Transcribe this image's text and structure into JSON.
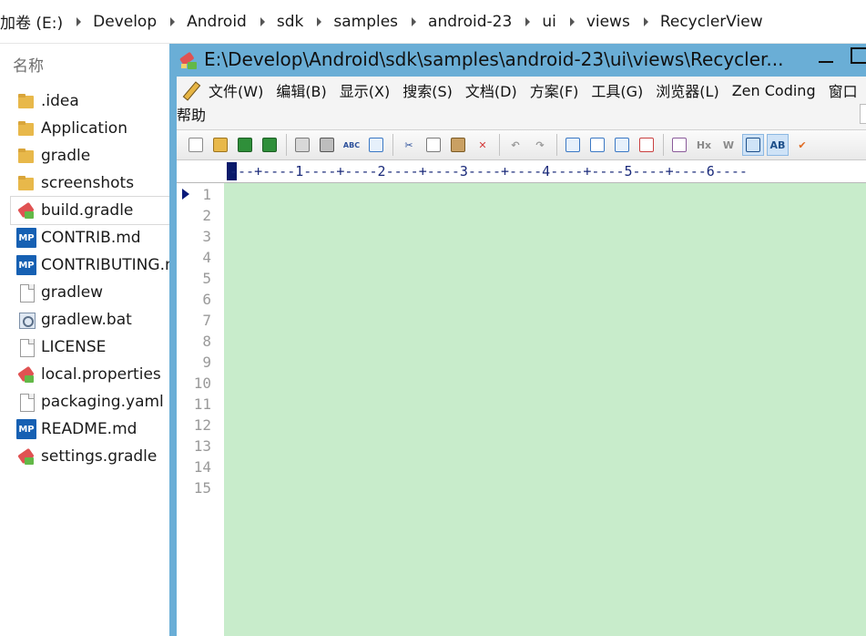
{
  "breadcrumb": [
    "加卷 (E:)",
    "Develop",
    "Android",
    "sdk",
    "samples",
    "android-23",
    "ui",
    "views",
    "RecyclerView"
  ],
  "explorer": {
    "column_header": "名称",
    "files": [
      {
        "name": ".idea",
        "icon": "folder-icon",
        "kind": "folder"
      },
      {
        "name": "Application",
        "icon": "folder-icon",
        "kind": "folder"
      },
      {
        "name": "gradle",
        "icon": "folder-icon",
        "kind": "folder"
      },
      {
        "name": "screenshots",
        "icon": "folder-icon",
        "kind": "folder"
      },
      {
        "name": "build.gradle",
        "icon": "editplus-file-icon",
        "kind": "ep",
        "selected": true
      },
      {
        "name": "CONTRIB.md",
        "icon": "markdown-file-icon",
        "kind": "md",
        "badge": "MP"
      },
      {
        "name": "CONTRIBUTING.md",
        "icon": "markdown-file-icon",
        "kind": "md",
        "badge": "MP"
      },
      {
        "name": "gradlew",
        "icon": "blank-file-icon",
        "kind": "doc"
      },
      {
        "name": "gradlew.bat",
        "icon": "batch-file-icon",
        "kind": "bat"
      },
      {
        "name": "LICENSE",
        "icon": "blank-file-icon",
        "kind": "doc"
      },
      {
        "name": "local.properties",
        "icon": "editplus-file-icon",
        "kind": "ep"
      },
      {
        "name": "packaging.yaml",
        "icon": "blank-file-icon",
        "kind": "doc"
      },
      {
        "name": "README.md",
        "icon": "markdown-file-icon",
        "kind": "md",
        "badge": "MP"
      },
      {
        "name": "settings.gradle",
        "icon": "editplus-file-icon",
        "kind": "ep"
      }
    ]
  },
  "editor": {
    "title": "E:\\Develop\\Android\\sdk\\samples\\android-23\\ui\\views\\Recycler...",
    "menu_row1": [
      "文件(W)",
      "编辑(B)",
      "显示(X)",
      "搜索(S)",
      "文档(D)",
      "方案(F)",
      "工具(G)",
      "浏览器(L)",
      "Zen Coding",
      "窗口"
    ],
    "menu_row2": [
      "帮助"
    ],
    "toolbar": [
      {
        "icon": "new-file-icon"
      },
      {
        "icon": "open-folder-icon"
      },
      {
        "icon": "save-icon"
      },
      {
        "icon": "save-all-icon"
      },
      {
        "sep": true
      },
      {
        "icon": "print-preview-icon"
      },
      {
        "icon": "print-icon"
      },
      {
        "icon": "spell-check-icon",
        "glyph": "ABC"
      },
      {
        "icon": "browser-preview-icon"
      },
      {
        "sep": true
      },
      {
        "icon": "cut-icon",
        "glyph": "✂"
      },
      {
        "icon": "copy-icon"
      },
      {
        "icon": "paste-icon"
      },
      {
        "icon": "delete-icon",
        "glyph": "✕"
      },
      {
        "sep": true
      },
      {
        "icon": "undo-icon",
        "glyph": "↶"
      },
      {
        "icon": "redo-icon",
        "glyph": "↷"
      },
      {
        "sep": true
      },
      {
        "icon": "find-icon"
      },
      {
        "icon": "replace-icon"
      },
      {
        "icon": "find-in-files-icon"
      },
      {
        "icon": "goto-line-icon"
      },
      {
        "sep": true
      },
      {
        "icon": "font-size-icon"
      },
      {
        "icon": "hex-view-icon",
        "glyph": "Hx"
      },
      {
        "icon": "word-wrap-icon",
        "glyph": "W"
      },
      {
        "icon": "indent-icon",
        "active": true
      },
      {
        "icon": "column-select-icon",
        "glyph": "AB",
        "active": true
      },
      {
        "icon": "check-icon",
        "glyph": "✔"
      }
    ],
    "ruler_text": "---+----1----+----2----+----3----+----4----+----5----+----6----",
    "line_numbers": [
      "1",
      "2",
      "3",
      "4",
      "5",
      "6",
      "7",
      "8",
      "9",
      "10",
      "11",
      "12",
      "13",
      "14",
      "15"
    ],
    "colors": {
      "text_bg": "#c8eccb",
      "frame": "#6aaed6",
      "ruler_text": "#1a2a7a"
    }
  }
}
